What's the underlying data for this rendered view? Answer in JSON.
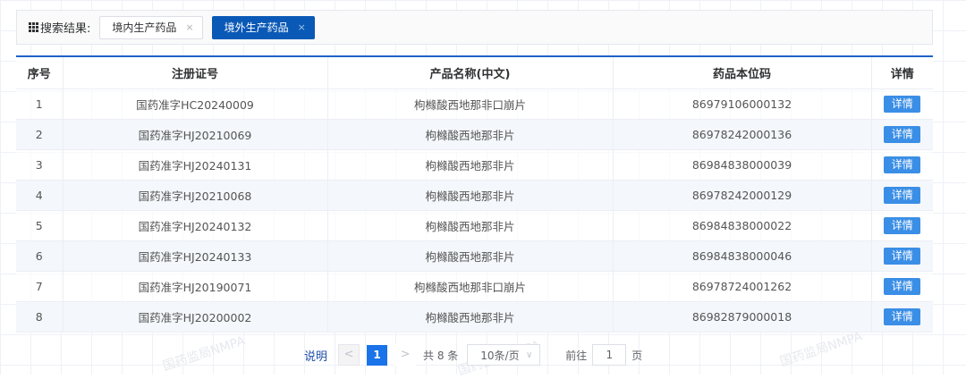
{
  "search": {
    "label": "搜索结果:",
    "tags": [
      {
        "label": "境内生产药品",
        "close": "×",
        "active": false
      },
      {
        "label": "境外生产药品",
        "close": "×",
        "active": true
      }
    ]
  },
  "table": {
    "headers": [
      "序号",
      "注册证号",
      "产品名称(中文)",
      "药品本位码",
      "详情"
    ],
    "rows": [
      {
        "no": "1",
        "reg": "国药准字HC20240009",
        "name": "枸橼酸西地那非口崩片",
        "code": "86979106000132",
        "action": "详情"
      },
      {
        "no": "2",
        "reg": "国药准字HJ20210069",
        "name": "枸橼酸西地那非片",
        "code": "86978242000136",
        "action": "详情"
      },
      {
        "no": "3",
        "reg": "国药准字HJ20240131",
        "name": "枸橼酸西地那非片",
        "code": "86984838000039",
        "action": "详情"
      },
      {
        "no": "4",
        "reg": "国药准字HJ20210068",
        "name": "枸橼酸西地那非片",
        "code": "86978242000129",
        "action": "详情"
      },
      {
        "no": "5",
        "reg": "国药准字HJ20240132",
        "name": "枸橼酸西地那非片",
        "code": "86984838000022",
        "action": "详情"
      },
      {
        "no": "6",
        "reg": "国药准字HJ20240133",
        "name": "枸橼酸西地那非片",
        "code": "86984838000046",
        "action": "详情"
      },
      {
        "no": "7",
        "reg": "国药准字HJ20190071",
        "name": "枸橼酸西地那非口崩片",
        "code": "86978724001262",
        "action": "详情"
      },
      {
        "no": "8",
        "reg": "国药准字HJ20200002",
        "name": "枸橼酸西地那非片",
        "code": "86982879000018",
        "action": "详情"
      }
    ]
  },
  "pager": {
    "note": "说明",
    "prev": "<",
    "current": "1",
    "next": ">",
    "total": "共 8 条",
    "page_size": "10条/页",
    "goto_label": "前往",
    "goto_value": "1",
    "goto_suffix": "页"
  },
  "watermark": "国药监局NMPA"
}
